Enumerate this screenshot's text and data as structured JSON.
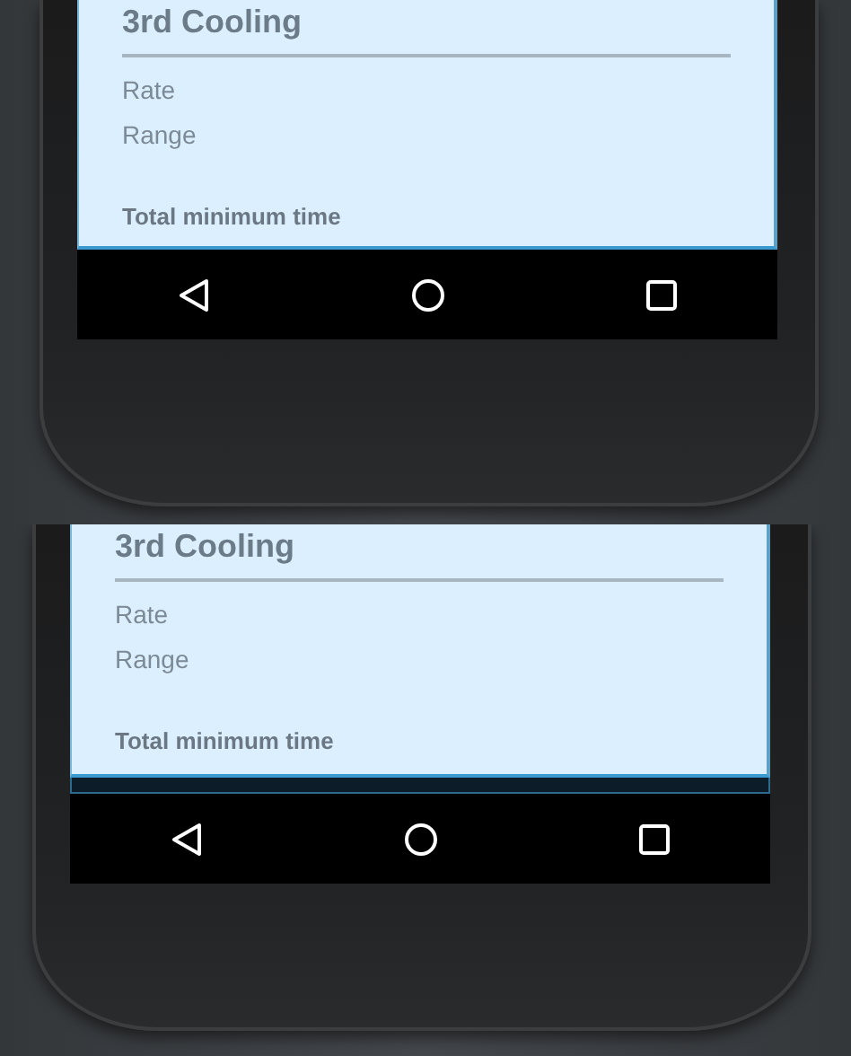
{
  "panels": [
    {
      "title": "3rd Cooling",
      "fields": [
        "Rate",
        "Range"
      ],
      "total": "Total minimum time"
    },
    {
      "title": "3rd Cooling",
      "fields": [
        "Rate",
        "Range"
      ],
      "total": "Total minimum time"
    }
  ]
}
